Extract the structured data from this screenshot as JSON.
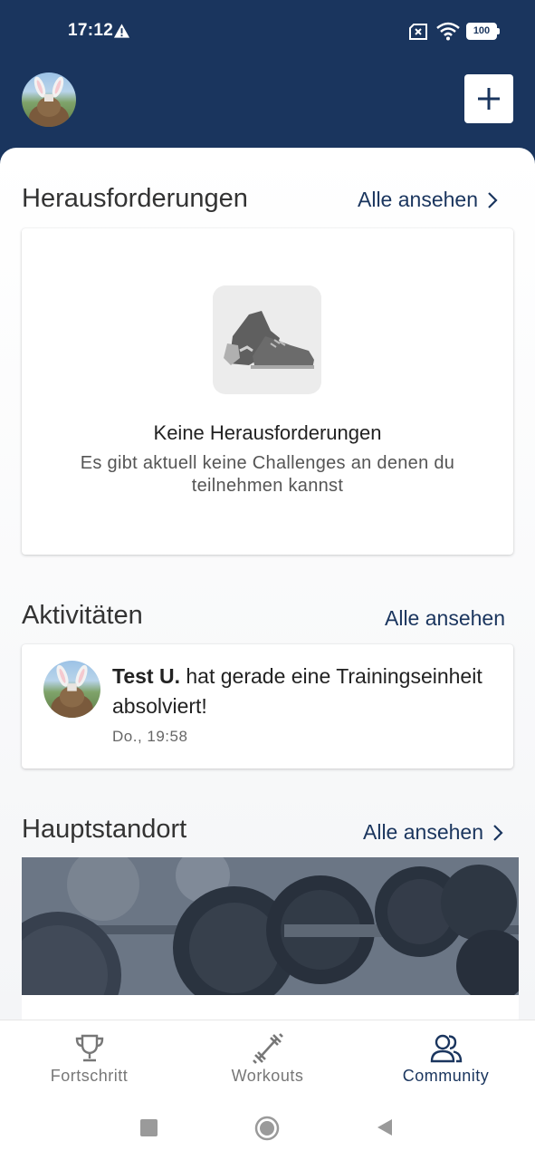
{
  "status_bar": {
    "time": "17:12",
    "battery": "100"
  },
  "colors": {
    "brand": "#1a355e",
    "text_dark": "#222222",
    "text_muted": "#666666"
  },
  "sections": {
    "challenges": {
      "title": "Herausforderungen",
      "see_all": "Alle ansehen",
      "empty_title": "Keine Herausforderungen",
      "empty_text": "Es gibt aktuell keine Challenges an denen du teilnehmen kannst"
    },
    "activities": {
      "title": "Aktivitäten",
      "see_all": "Alle ansehen",
      "items": [
        {
          "user": "Test U.",
          "text": " hat gerade eine Trainingseinheit absolviert!",
          "time": "Do., 19:58"
        }
      ]
    },
    "location": {
      "title": "Hauptstandort",
      "see_all": "Alle ansehen"
    }
  },
  "bottom_nav": {
    "items": [
      {
        "label": "Fortschritt",
        "icon": "trophy-icon",
        "active": false
      },
      {
        "label": "Workouts",
        "icon": "dumbbell-icon",
        "active": false
      },
      {
        "label": "Community",
        "icon": "people-icon",
        "active": true
      }
    ]
  },
  "icons": {
    "header_add": "plus-icon",
    "empty_challenges": "sneakers-icon",
    "see_all": "chevron-right-icon"
  }
}
